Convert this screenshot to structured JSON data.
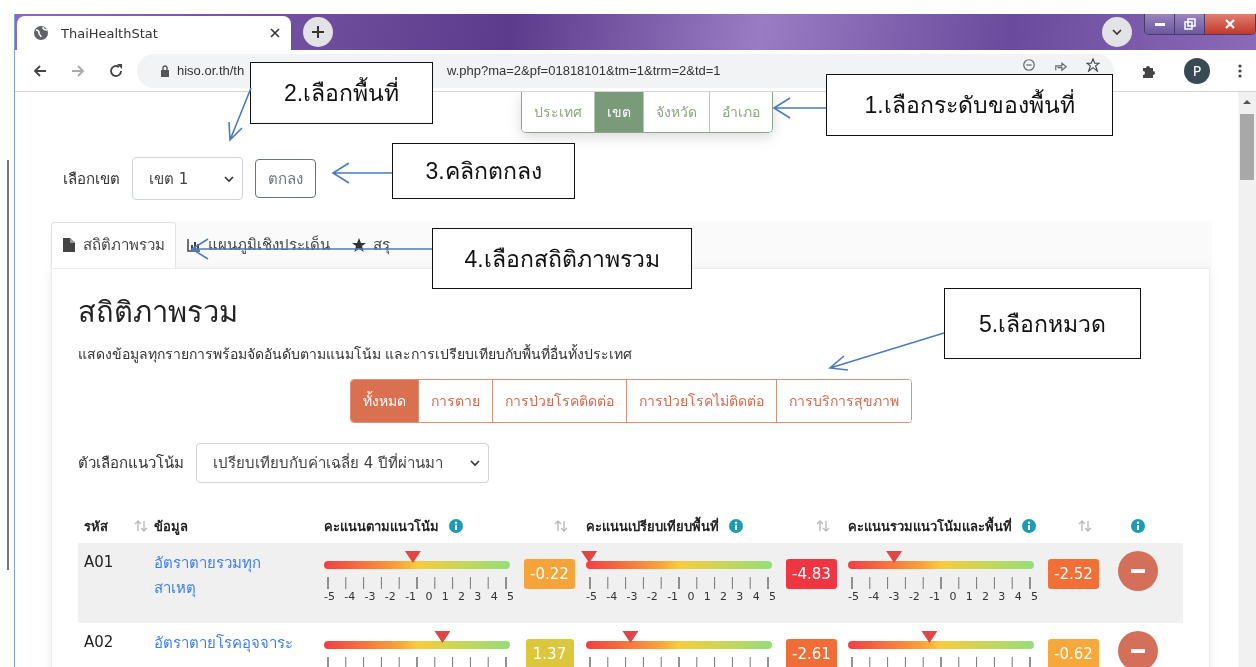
{
  "browser": {
    "tab_title": "ThaiHealthStat",
    "url_start": "hiso.or.th/th",
    "url_end": "w.php?ma=2&pf=01818101&tm=1&trm=2&td=1",
    "avatar": "P"
  },
  "levels": [
    {
      "label": "ประเทศ",
      "selected": false
    },
    {
      "label": "เขต",
      "selected": true
    },
    {
      "label": "จังหวัด",
      "selected": false
    },
    {
      "label": "อำเภอ",
      "selected": false
    }
  ],
  "area_picker": {
    "label": "เลือกเขต",
    "value": "เขต 1",
    "button": "ตกลง"
  },
  "tabs": [
    {
      "label": "สถิติภาพรวม",
      "selected": true
    },
    {
      "label": "แผนภูมิเชิงประเด็น",
      "selected": false
    },
    {
      "label": "สรุ",
      "selected": false
    }
  ],
  "title": "สถิติภาพรวม",
  "subtitle": "แสดงข้อมูลทุกรายการพร้อมจัดอันดับตามแนมโน้ม และการเปรียบเทียบกับพื้นที่อื่นทั้งประเทศ",
  "categories": [
    {
      "label": "ทั้งหมด",
      "selected": true
    },
    {
      "label": "การตาย",
      "selected": false
    },
    {
      "label": "การป่วยโรคติดต่อ",
      "selected": false
    },
    {
      "label": "การป่วยโรคไม่ติดต่อ",
      "selected": false
    },
    {
      "label": "การบริการสุขภาพ",
      "selected": false
    }
  ],
  "trend_option": {
    "label": "ตัวเลือกแนวโน้ม",
    "value": "เปรียบเทียบกับค่าเฉลี่ย 4 ปีที่ผ่านมา"
  },
  "table": {
    "columns": [
      "รหัส",
      "ข้อมูล",
      "คะแนนตามแนวโน้ม",
      "คะแนนเปรียบเทียบพื้นที่",
      "คะแนนรวมแนวโน้มและพื้นที่"
    ],
    "rows": [
      {
        "code": "A01",
        "name": "อัตราตายรวมทุกสาเหตุ",
        "scores": [
          {
            "level": 0.478,
            "value": "-0.22",
            "color": "#f5a43a",
            "ticks": [
              "-5",
              "-4",
              "-3",
              "-2",
              "-1",
              "0",
              "1",
              "2",
              "3",
              "4",
              "5"
            ]
          },
          {
            "level": 0.017,
            "value": "-4.83",
            "color": "#ef3442",
            "ticks": [
              "-5",
              "-4",
              "-3",
              "-2",
              "-1",
              "0",
              "1",
              "2",
              "3",
              "4",
              "5"
            ]
          },
          {
            "level": 0.248,
            "value": "-2.52",
            "color": "#f27038",
            "ticks": [
              "-5",
              "-4",
              "-3",
              "-2",
              "-1",
              "0",
              "1",
              "2",
              "3",
              "4",
              "5"
            ]
          }
        ]
      },
      {
        "code": "A02",
        "name": "อัตราตายโรคอุจจาระ",
        "scores": [
          {
            "level": 0.637,
            "value": "1.37",
            "color": "#dbc63c"
          },
          {
            "level": 0.239,
            "value": "-2.61",
            "color": "#f06d37"
          },
          {
            "level": 0.438,
            "value": "-0.62",
            "color": "#f6a83b"
          }
        ]
      }
    ]
  },
  "annotations": [
    {
      "text": "1.เลือกระดับของพื้นที่"
    },
    {
      "text": "2.เลือกพื้นที่"
    },
    {
      "text": "3.คลิกตกลง"
    },
    {
      "text": "4.เลือกสถิติภาพรวม"
    },
    {
      "text": "5.เลือกหมวด"
    }
  ]
}
